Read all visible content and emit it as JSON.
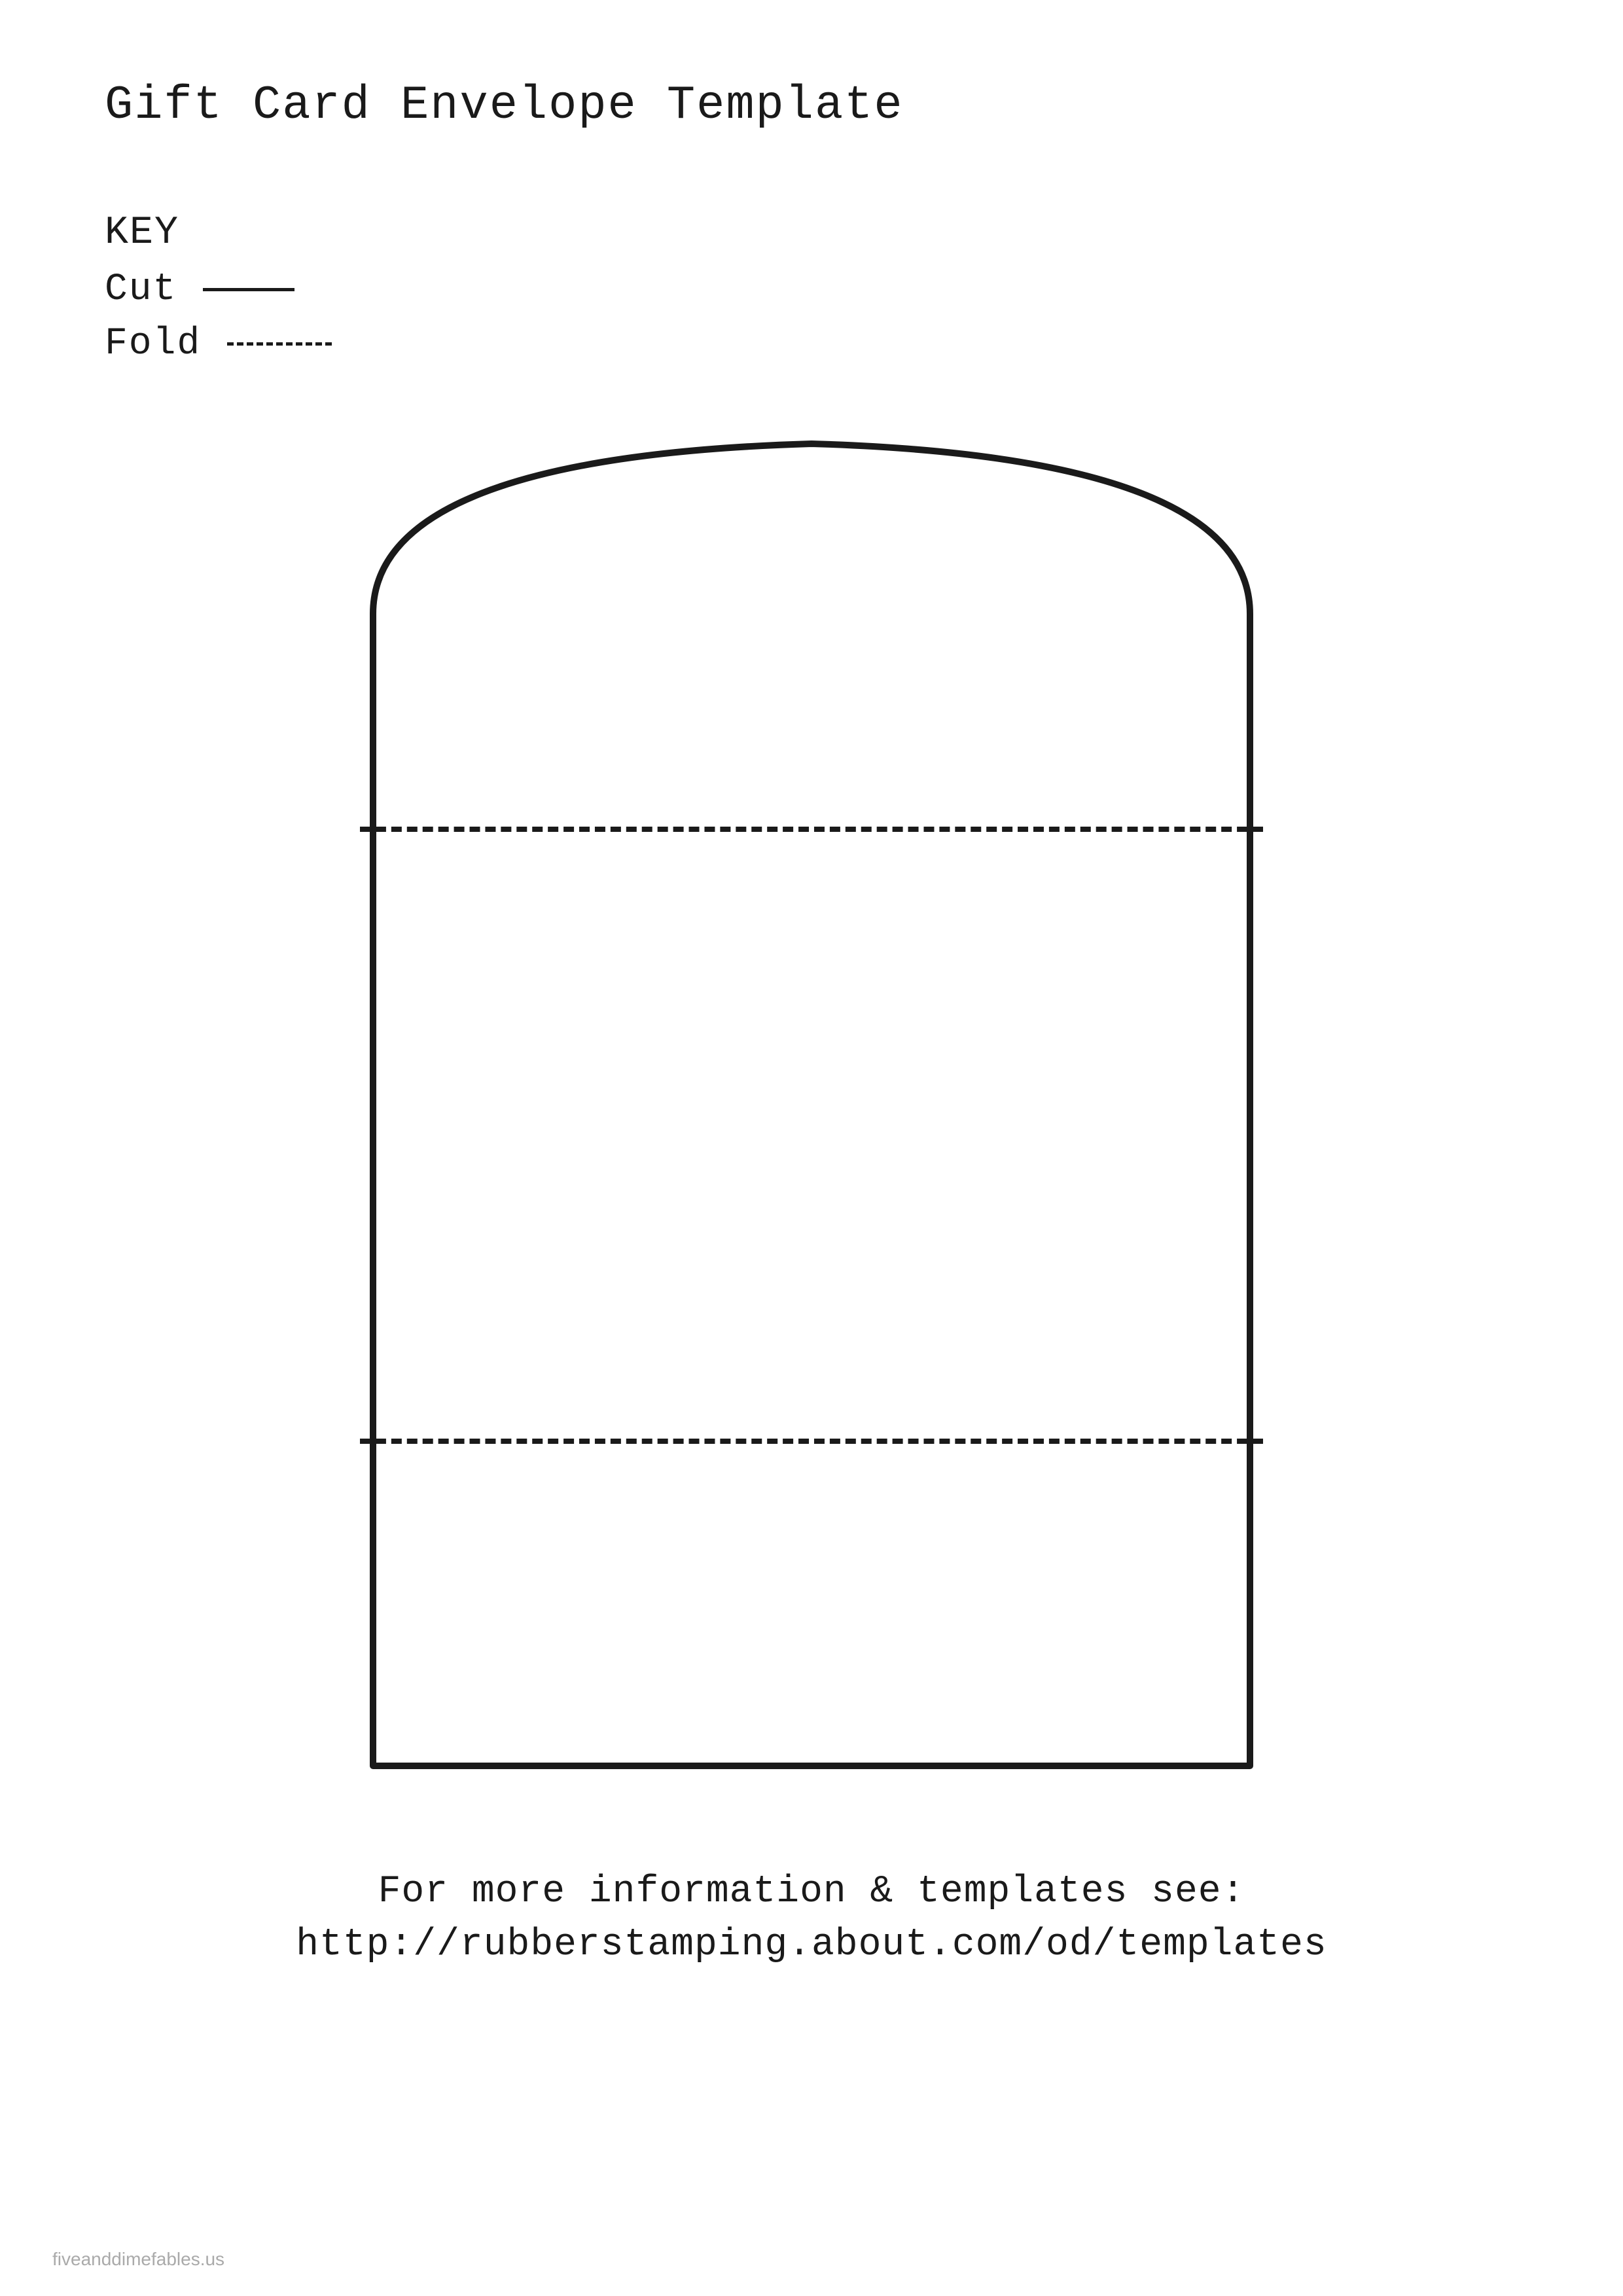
{
  "page": {
    "title": "Gift Card Envelope Template",
    "key": {
      "label": "KEY",
      "cut_label": "Cut",
      "fold_label": "Fold"
    },
    "footer": {
      "line1": "For more information & templates see:",
      "line2": "http://rubberstamping.about.com/od/templates"
    },
    "watermark": "fiveanddimefables.us"
  }
}
